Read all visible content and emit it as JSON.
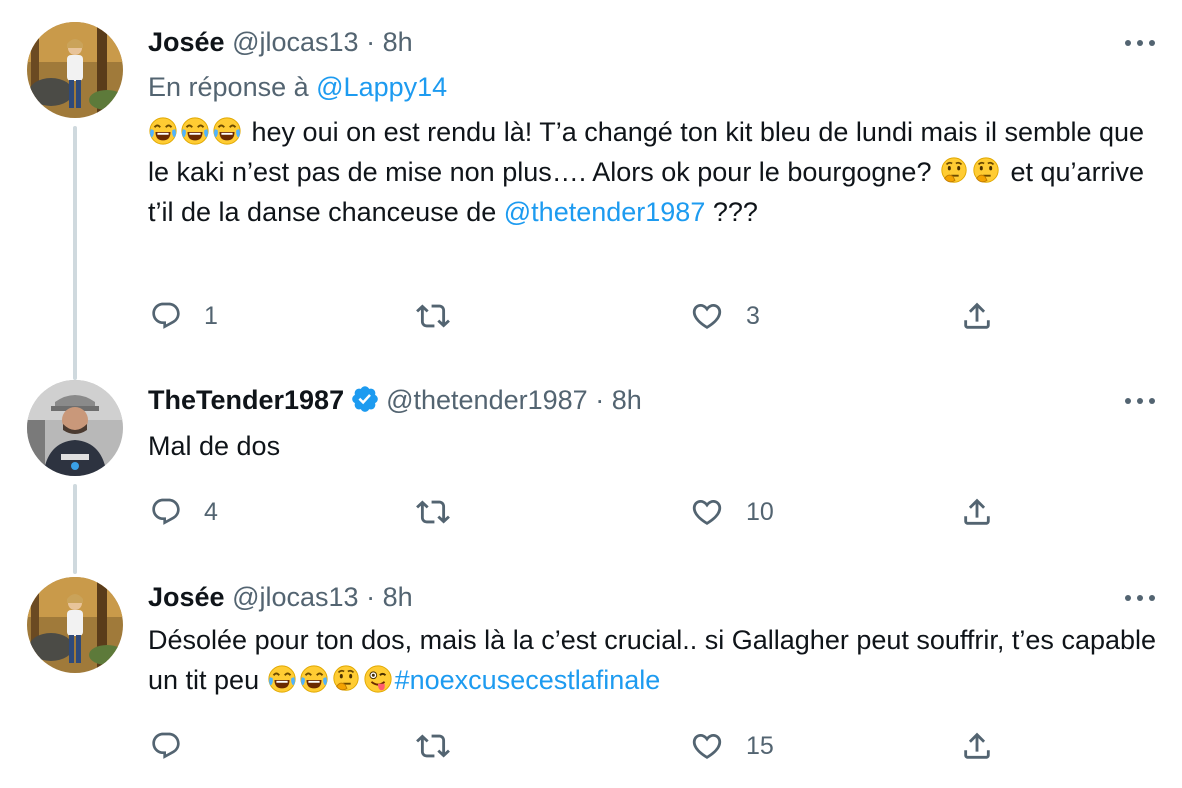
{
  "tweets": [
    {
      "name": "Josée",
      "handle": "@jlocas13",
      "separator": "·",
      "time": "8h",
      "reply_prefix": "En réponse à",
      "reply_handle": "@Lappy14",
      "text_a": "hey oui on est rendu là! T’a changé ton kit bleu de lundi mais  il semble que le kaki n’est pas de mise non plus…. Alors ok pour le bourgogne?",
      "text_b": "et qu’arrive t’il de la danse chanceuse de",
      "mention": "@thetender1987",
      "text_c": "???",
      "replies": "1",
      "retweets": "",
      "likes": "3"
    },
    {
      "name": "TheTender1987",
      "handle": "@thetender1987",
      "separator": "·",
      "time": "8h",
      "text": "Mal de dos",
      "replies": "4",
      "retweets": "",
      "likes": "10"
    },
    {
      "name": "Josée",
      "handle": "@jlocas13",
      "separator": "·",
      "time": "8h",
      "text_a": "Désolée pour ton dos, mais là la c’est crucial.. si Gallagher peut souffrir, t’es capable un tit peu",
      "hashtag": "#noexcusecestlafinale",
      "replies": "",
      "retweets": "",
      "likes": "15"
    }
  ],
  "icons": [
    "avatar",
    "verified-badge-icon",
    "more-icon",
    "reply-icon",
    "retweet-icon",
    "like-icon",
    "share-icon",
    "laughing-tears-emoji",
    "thinking-face-emoji",
    "winking-tongue-emoji"
  ],
  "colors": {
    "accent": "#1d9bf0",
    "secondary_text": "#536471",
    "thread_line": "#cfd9de"
  }
}
